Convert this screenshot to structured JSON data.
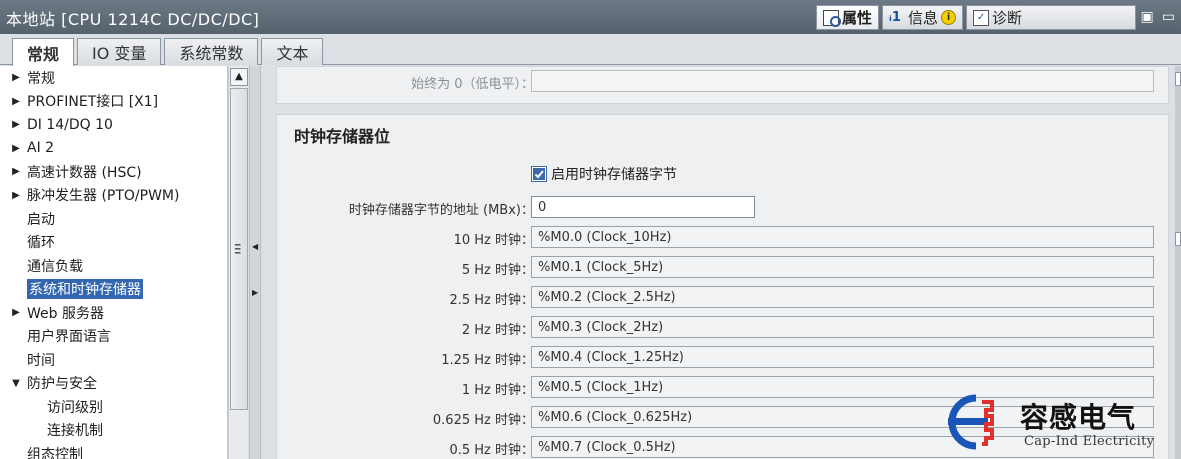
{
  "window": {
    "title": "本地站 [CPU 1214C DC/DC/DC]"
  },
  "inspector_tabs": [
    {
      "label": "属性",
      "icon": "properties-icon",
      "active": true
    },
    {
      "label": "信息",
      "icon": "info-icon",
      "active": false
    },
    {
      "label": "诊断",
      "icon": "diagnostics-icon",
      "active": false
    }
  ],
  "general_tabs": [
    {
      "label": "常规",
      "active": true
    },
    {
      "label": "IO 变量",
      "active": false
    },
    {
      "label": "系统常数",
      "active": false
    },
    {
      "label": "文本",
      "active": false
    }
  ],
  "nav": {
    "items": [
      {
        "label": "常规",
        "arrow": "▶"
      },
      {
        "label": "PROFINET接口 [X1]",
        "arrow": "▶"
      },
      {
        "label": "DI 14/DQ 10",
        "arrow": "▶"
      },
      {
        "label": "AI 2",
        "arrow": "▶"
      },
      {
        "label": "高速计数器 (HSC)",
        "arrow": "▶"
      },
      {
        "label": "脉冲发生器 (PTO/PWM)",
        "arrow": "▶"
      },
      {
        "label": "启动",
        "arrow": ""
      },
      {
        "label": "循环",
        "arrow": ""
      },
      {
        "label": "通信负载",
        "arrow": ""
      },
      {
        "label": "系统和时钟存储器",
        "arrow": "",
        "selected": true
      },
      {
        "label": "Web 服务器",
        "arrow": "▶"
      },
      {
        "label": "用户界面语言",
        "arrow": ""
      },
      {
        "label": "时间",
        "arrow": ""
      },
      {
        "label": "防护与安全",
        "arrow": "▼"
      },
      {
        "label": "访问级别",
        "arrow": "",
        "level": 1
      },
      {
        "label": "连接机制",
        "arrow": "",
        "level": 1
      },
      {
        "label": "组态控制",
        "arrow": ""
      }
    ]
  },
  "content": {
    "always_low_label": "始终为 0（低电平）：",
    "always_low_value": "",
    "clock_section_title": "时钟存储器位",
    "enable_clock_byte_label": "启用时钟存储器字节",
    "enable_clock_byte_checked": true,
    "clock_byte_address_label": "时钟存储器字节的地址 (MBx)：",
    "clock_byte_address_value": "0",
    "clocks": [
      {
        "label": "10 Hz 时钟：",
        "value": "%M0.0 (Clock_10Hz)"
      },
      {
        "label": "5 Hz 时钟：",
        "value": "%M0.1 (Clock_5Hz)"
      },
      {
        "label": "2.5 Hz 时钟：",
        "value": "%M0.2 (Clock_2.5Hz)"
      },
      {
        "label": "2 Hz 时钟：",
        "value": "%M0.3 (Clock_2Hz)"
      },
      {
        "label": "1.25 Hz 时钟：",
        "value": "%M0.4 (Clock_1.25Hz)"
      },
      {
        "label": "1 Hz 时钟：",
        "value": "%M0.5 (Clock_1Hz)"
      },
      {
        "label": "0.625 Hz 时钟：",
        "value": "%M0.6 (Clock_0.625Hz)"
      },
      {
        "label": "0.5 Hz 时钟：",
        "value": "%M0.7 (Clock_0.5Hz)"
      }
    ]
  },
  "watermark": {
    "cn": "容感电气",
    "en": "Cap-Ind Electricity"
  },
  "colors": {
    "titlebar": "#5f6b76",
    "selection": "#3368b0",
    "logo_blue": "#1a56b8",
    "logo_red": "#e0322c"
  }
}
